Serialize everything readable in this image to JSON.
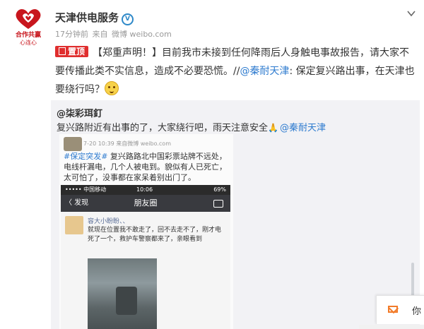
{
  "author": {
    "name": "天津供电服务",
    "verified_label": "V",
    "logo_text": "合作共赢",
    "logo_subtext": "心连心"
  },
  "meta": {
    "time": "17分钟前",
    "source_prefix": "来自",
    "source": "微博 weibo.com"
  },
  "post": {
    "pin_label": "置顶",
    "text_main": "【郑重声明！】目前我市未接到任何降雨后人身触电事故报告，请大家不要传播此类不实信息，造成不必要恐慌。//",
    "mention": "@秦耐天津",
    "text_tail": ": 保定复兴路出事，在天津也要绕行吗？",
    "emoji": "confused-face-emoji"
  },
  "repost": {
    "user": "@柒彩珥釘",
    "text": "复兴路附近有出事的了，大家绕行吧，雨天注意安全",
    "mention": "@秦耐天津"
  },
  "embedded": {
    "date": "7-20 10:39 来自微博 weibo.com",
    "tag": "#保定突发#",
    "text": "复兴路路北中国彩票站牌不远处，电线杆漏电，几个人被电到。貌似有人已死亡，太可怕了，没事都在家呆着别出门了。",
    "status_left": "••••• 中国移动",
    "status_time": "10:06",
    "status_right": "69%",
    "back_label": "〈 发现",
    "nav_title": "朋友圈",
    "post_user": "容大小盼盼、、",
    "post_text": "就现在位置我不敢走了，回不去走不了，刚才电死了一个，救护车警察都来了，亲眼看到"
  },
  "chat": {
    "label": "你"
  }
}
